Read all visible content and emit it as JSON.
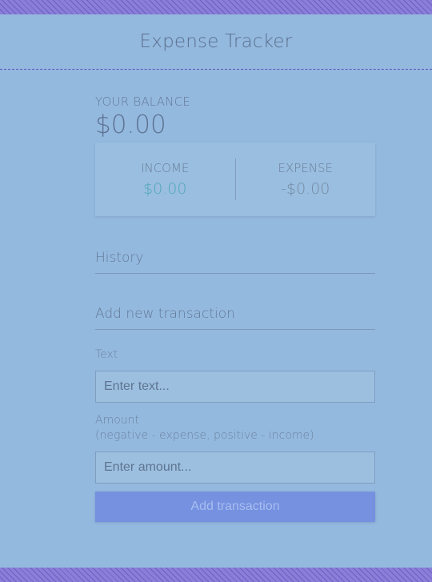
{
  "header": {
    "title": "Expense Tracker"
  },
  "balance": {
    "label": "Your Balance",
    "value": "$0.00"
  },
  "summary": {
    "income_label": "Income",
    "income_value": "$0.00",
    "expense_label": "Expense",
    "expense_value": "-$0.00"
  },
  "history": {
    "title": "History"
  },
  "form": {
    "title": "Add new transaction",
    "text_label": "Text",
    "text_placeholder": "Enter text...",
    "amount_label": "Amount",
    "amount_hint": "(negative - expense, positive - income)",
    "amount_placeholder": "Enter amount...",
    "submit_label": "Add transaction"
  },
  "colors": {
    "background": "#94b9df",
    "accent": "#7591e0",
    "income": "#4ea8b4",
    "stripe": "#8a7ed8"
  }
}
